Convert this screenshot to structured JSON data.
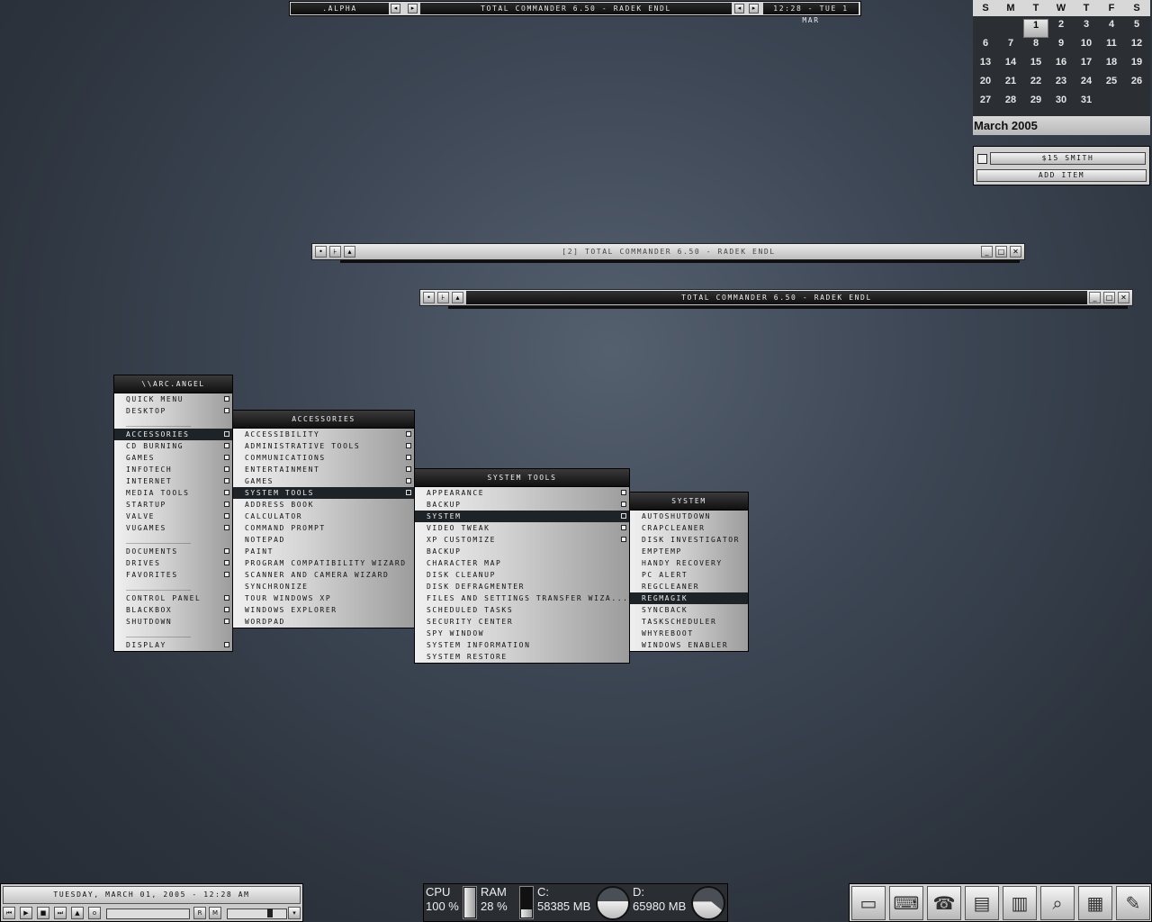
{
  "toolbar": {
    "workspace": ".alpha",
    "task_title": "total commander 6.50 - radek endl",
    "clock": "12:28 - tue 1 mar"
  },
  "calendar": {
    "weekdays": [
      "S",
      "M",
      "T",
      "W",
      "T",
      "F",
      "S"
    ],
    "days": [
      "",
      "",
      "1",
      "2",
      "3",
      "4",
      "5",
      "6",
      "7",
      "8",
      "9",
      "10",
      "11",
      "12",
      "13",
      "14",
      "15",
      "16",
      "17",
      "18",
      "19",
      "20",
      "21",
      "22",
      "23",
      "24",
      "25",
      "26",
      "27",
      "28",
      "29",
      "30",
      "31",
      "",
      ""
    ],
    "today": "1",
    "month": "March 2005"
  },
  "todo": {
    "item": "$15 smith",
    "add_label": "add item"
  },
  "windows": {
    "back_title": "[2] total commander 6.50 - radek endl",
    "front_title": "total commander 6.50 - radek endl",
    "button_icons": [
      "pin-icon",
      "roll-icon",
      "shade-icon",
      "minimize-icon",
      "maximize-icon",
      "close-icon"
    ]
  },
  "root_menu": {
    "title": "\\\\arc.angel",
    "items": [
      {
        "label": "quick menu",
        "sub": true
      },
      {
        "label": "desktop",
        "sub": true
      },
      {
        "sep": "_______________"
      },
      {
        "label": "accessories",
        "sub": true,
        "hl": true
      },
      {
        "label": "cd burning",
        "sub": true
      },
      {
        "label": "games",
        "sub": true
      },
      {
        "label": "infotech",
        "sub": true
      },
      {
        "label": "internet",
        "sub": true
      },
      {
        "label": "media tools",
        "sub": true
      },
      {
        "label": "startup",
        "sub": true
      },
      {
        "label": "valve",
        "sub": true
      },
      {
        "label": "vugames",
        "sub": true
      },
      {
        "sep": "_______________"
      },
      {
        "label": "documents",
        "sub": true
      },
      {
        "label": "drives",
        "sub": true
      },
      {
        "label": "favorites",
        "sub": true
      },
      {
        "sep": "_______________"
      },
      {
        "label": "control panel",
        "sub": true
      },
      {
        "label": "blackbox",
        "sub": true
      },
      {
        "label": "shutdown",
        "sub": true
      },
      {
        "sep": "_______________"
      },
      {
        "label": "display",
        "sub": true
      }
    ]
  },
  "accessories_menu": {
    "title": "accessories",
    "items": [
      {
        "label": "accessibility",
        "sub": true
      },
      {
        "label": "administrative tools",
        "sub": true
      },
      {
        "label": "communications",
        "sub": true
      },
      {
        "label": "entertainment",
        "sub": true
      },
      {
        "label": "games",
        "sub": true
      },
      {
        "label": "system tools",
        "sub": true,
        "hl": true
      },
      {
        "label": "address book"
      },
      {
        "label": "calculator"
      },
      {
        "label": "command prompt"
      },
      {
        "label": "notepad"
      },
      {
        "label": "paint"
      },
      {
        "label": "program compatibility wizard"
      },
      {
        "label": "scanner and camera wizard"
      },
      {
        "label": "synchronize"
      },
      {
        "label": "tour windows xp"
      },
      {
        "label": "windows explorer"
      },
      {
        "label": "wordpad"
      }
    ]
  },
  "system_tools_menu": {
    "title": "system tools",
    "items": [
      {
        "label": "appearance",
        "sub": true
      },
      {
        "label": "backup",
        "sub": true
      },
      {
        "label": "system",
        "sub": true,
        "hl": true
      },
      {
        "label": "video tweak",
        "sub": true
      },
      {
        "label": "xp customize",
        "sub": true
      },
      {
        "label": "backup"
      },
      {
        "label": "character map"
      },
      {
        "label": "disk cleanup"
      },
      {
        "label": "disk defragmenter"
      },
      {
        "label": "files and settings transfer wiza..."
      },
      {
        "label": "scheduled tasks"
      },
      {
        "label": "security center"
      },
      {
        "label": "spy window"
      },
      {
        "label": "system information"
      },
      {
        "label": "system restore"
      }
    ]
  },
  "system_menu": {
    "title": "system",
    "items": [
      {
        "label": "autoshutdown"
      },
      {
        "label": "crapcleaner"
      },
      {
        "label": "disk investigator"
      },
      {
        "label": "emptemp"
      },
      {
        "label": "handy recovery"
      },
      {
        "label": "pc alert"
      },
      {
        "label": "regcleaner"
      },
      {
        "label": "regmagik",
        "hl": true
      },
      {
        "label": "syncback"
      },
      {
        "label": "taskscheduler"
      },
      {
        "label": "whyreboot"
      },
      {
        "label": "windows enabler"
      }
    ]
  },
  "player": {
    "datetime": "tuesday, march 01, 2005 - 12:28 am",
    "controls": [
      {
        "icon": "prev-icon",
        "glyph": "⏮"
      },
      {
        "icon": "play-icon",
        "glyph": "▶"
      },
      {
        "icon": "stop-icon",
        "glyph": "■"
      },
      {
        "icon": "next-icon",
        "glyph": "⏭"
      },
      {
        "icon": "eject-icon",
        "glyph": "▲"
      },
      {
        "icon": "open-icon",
        "glyph": "o"
      }
    ],
    "repeat_label": "R",
    "mode_label": "M",
    "volume_fraction": 0.75
  },
  "sysmon": {
    "cpu_label": "CPU",
    "cpu_value": "100 %",
    "cpu_fraction": 1.0,
    "ram_label": "RAM",
    "ram_value": "28 %",
    "ram_fraction": 0.28,
    "c_label": "C:",
    "c_value": "58385 MB",
    "d_label": "D:",
    "d_value": "65980 MB"
  },
  "tray_icons": [
    "drive-icon",
    "keyboard-icon",
    "phone-icon",
    "notepad-icon",
    "book-icon",
    "magnifier-icon",
    "calendar-icon",
    "pen-icon"
  ]
}
